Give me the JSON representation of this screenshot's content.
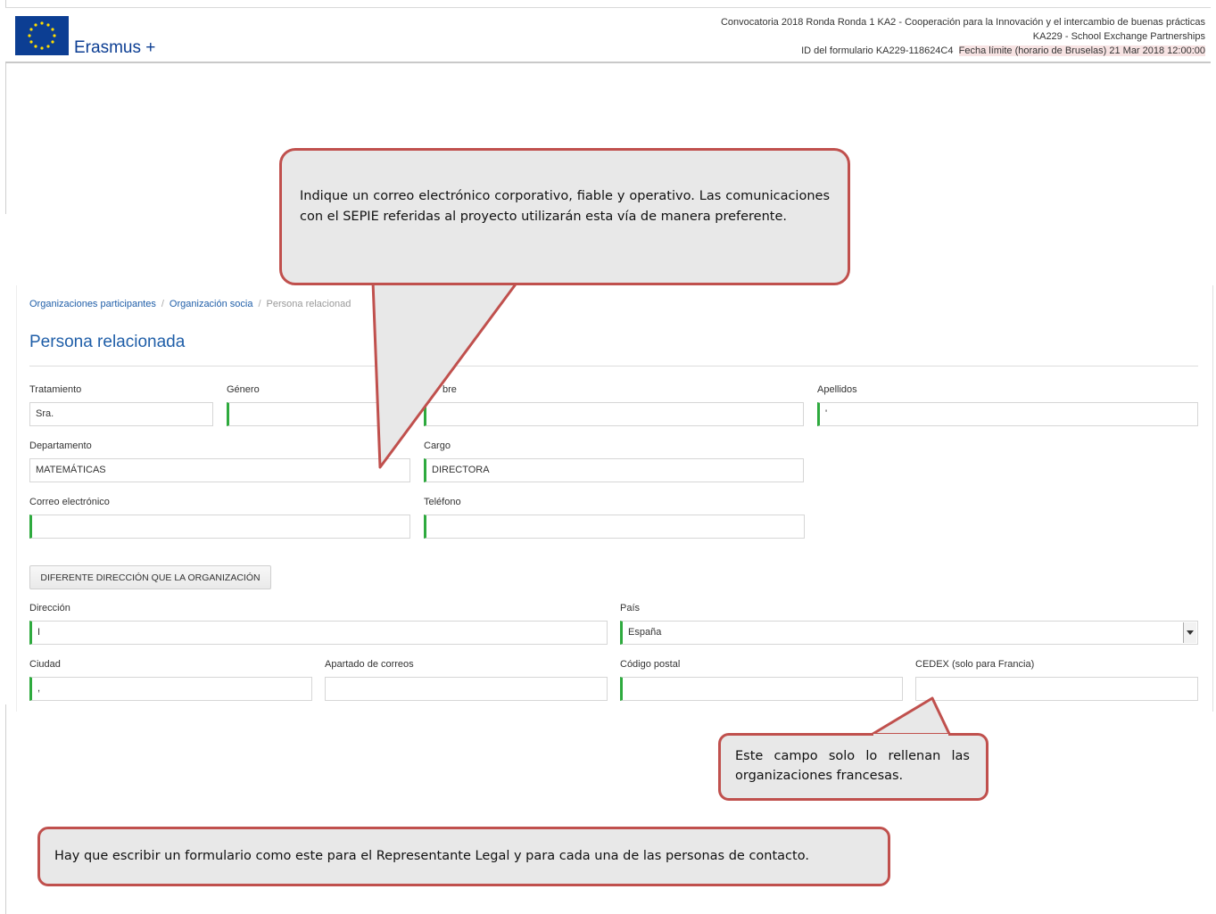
{
  "header": {
    "logo_text": "Erasmus +",
    "line1": "Convocatoria 2018  Ronda Ronda 1  KA2 - Cooperación para la Innovación y el intercambio de buenas prácticas",
    "line2": "KA229 - School Exchange Partnerships",
    "line3_id": "ID del formulario KA229-118624C4",
    "line3_deadline": "Fecha límite (horario de Bruselas) 21 Mar 2018 12:00:00"
  },
  "breadcrumb": {
    "item1": "Organizaciones participantes",
    "item2": "Organización socia",
    "item3": "Persona relacionad"
  },
  "page_title": "Persona relacionada",
  "fields": {
    "tratamiento": {
      "label": "Tratamiento",
      "value": "Sra."
    },
    "genero": {
      "label": "Género",
      "value": ""
    },
    "nombre": {
      "label": "bre",
      "value": ""
    },
    "apellidos": {
      "label": "Apellidos",
      "value": "'"
    },
    "departamento": {
      "label": "Departamento",
      "value": "MATEMÁTICAS"
    },
    "cargo": {
      "label": "Cargo",
      "value": "DIRECTORA"
    },
    "correo": {
      "label": "Correo electrónico",
      "value": ""
    },
    "telefono": {
      "label": "Teléfono",
      "value": ""
    },
    "direccion": {
      "label": "Dirección",
      "value": "I"
    },
    "pais": {
      "label": "País",
      "value": "España"
    },
    "ciudad": {
      "label": "Ciudad",
      "value": ","
    },
    "apartado": {
      "label": "Apartado de correos",
      "value": ""
    },
    "codigo_postal": {
      "label": "Código postal",
      "value": ""
    },
    "cedex": {
      "label": "CEDEX (solo para Francia)",
      "value": ""
    }
  },
  "address_button": "DIFERENTE DIRECCIÓN QUE LA ORGANIZACIÓN",
  "callouts": {
    "email_note": "Indique un correo electrónico corporativo, fiable y operativo. Las comunicaciones con el SEPIE referidas al proyecto utilizarán esta vía de manera preferente.",
    "cedex_note": "Este campo solo lo rellenan las organizaciones francesas.",
    "form_note": "Hay que escribir un formulario como este para el Representante  Legal y para cada una de las personas de contacto."
  },
  "colors": {
    "brand_blue": "#0c3e93",
    "link_blue": "#1f5ea8",
    "required_green": "#2eaa3e",
    "callout_border": "#c0504d",
    "callout_fill": "#e8e8e8"
  }
}
